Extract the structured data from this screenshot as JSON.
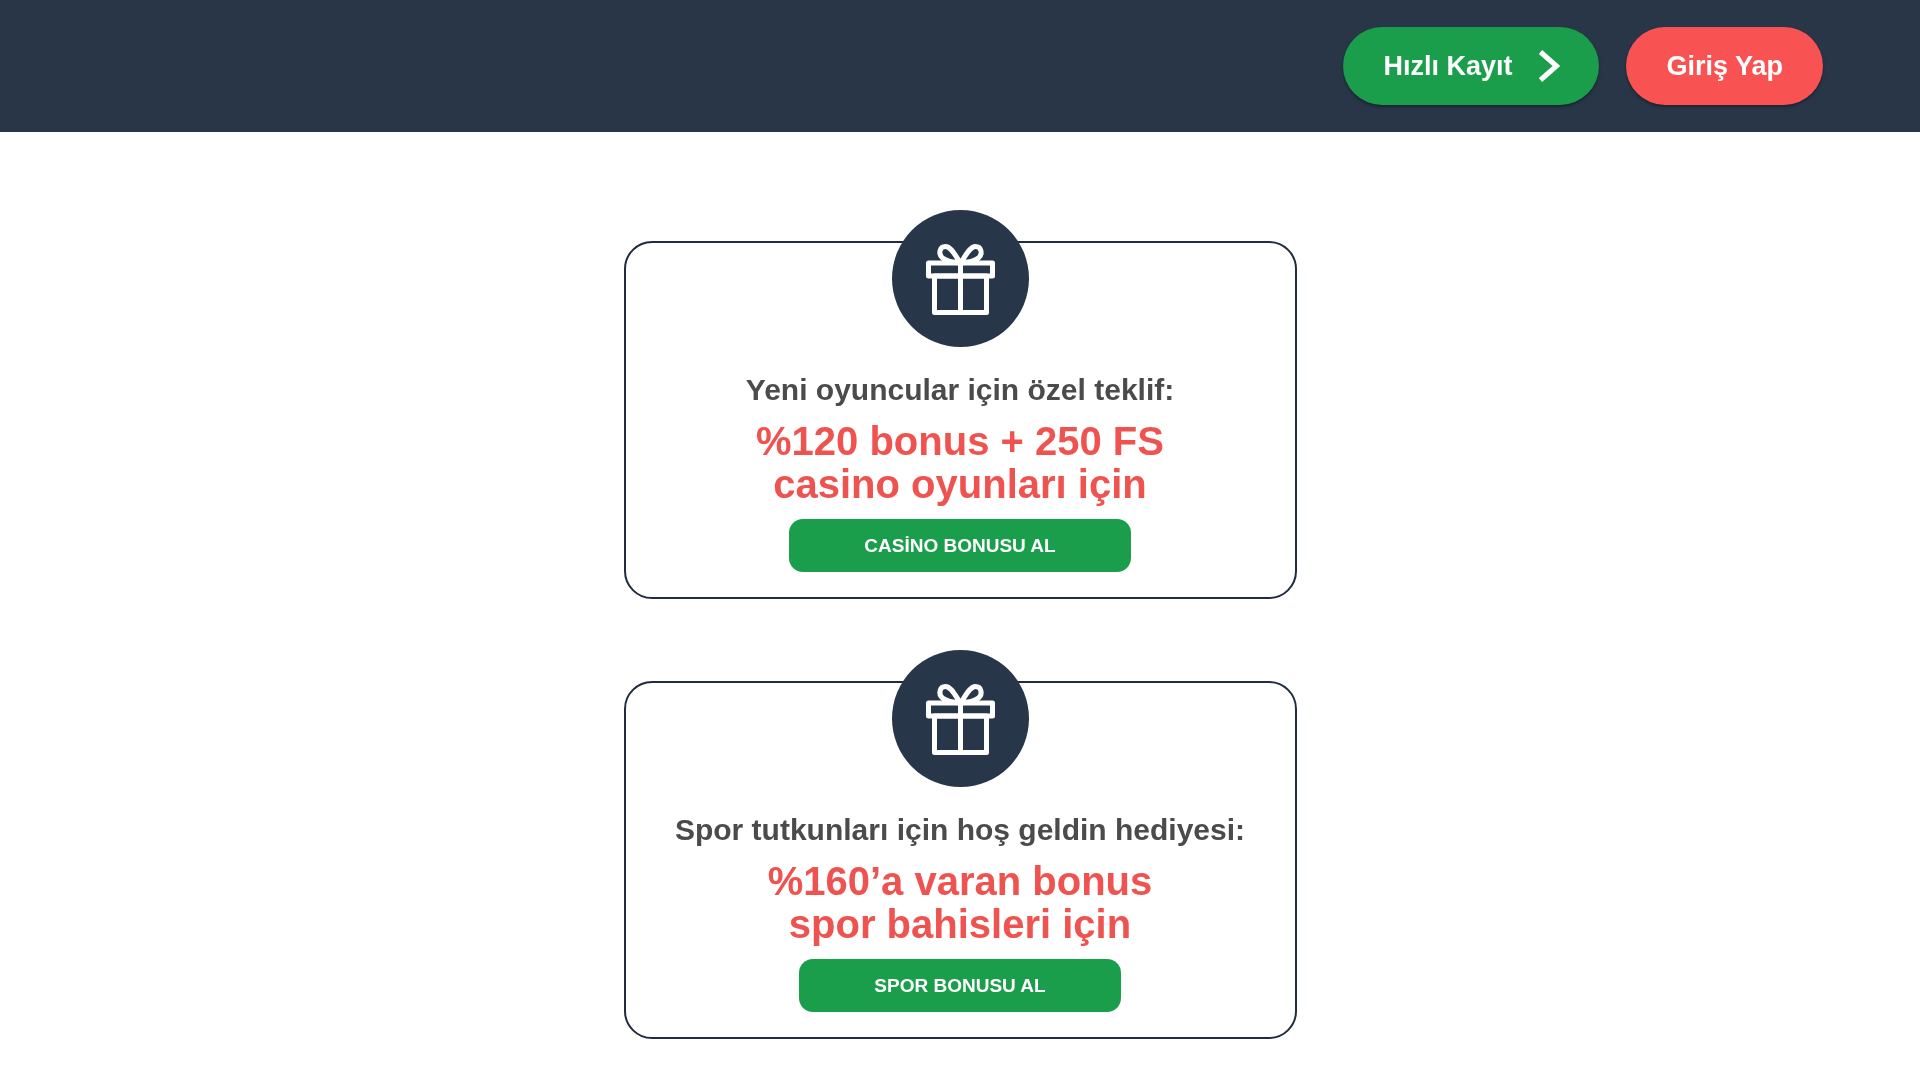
{
  "header": {
    "buttons": [
      {
        "kind": "register",
        "label": "Hızlı Kayıt"
      },
      {
        "kind": "login",
        "label": "Giriş Yap"
      }
    ]
  },
  "offers": [
    {
      "headline": "Yeni oyuncular için özel teklif:",
      "bonus_lines": [
        "%120 bonus + 250 FS",
        "casino oyunları için"
      ],
      "button": "CASİNO BONUSU AL"
    },
    {
      "headline": "Spor tutkunları için hoş geldin hediyesi:",
      "bonus_lines": [
        "%160’a varan bonus",
        "spor bahisleri için"
      ],
      "button": "SPOR BONUSU AL"
    }
  ]
}
